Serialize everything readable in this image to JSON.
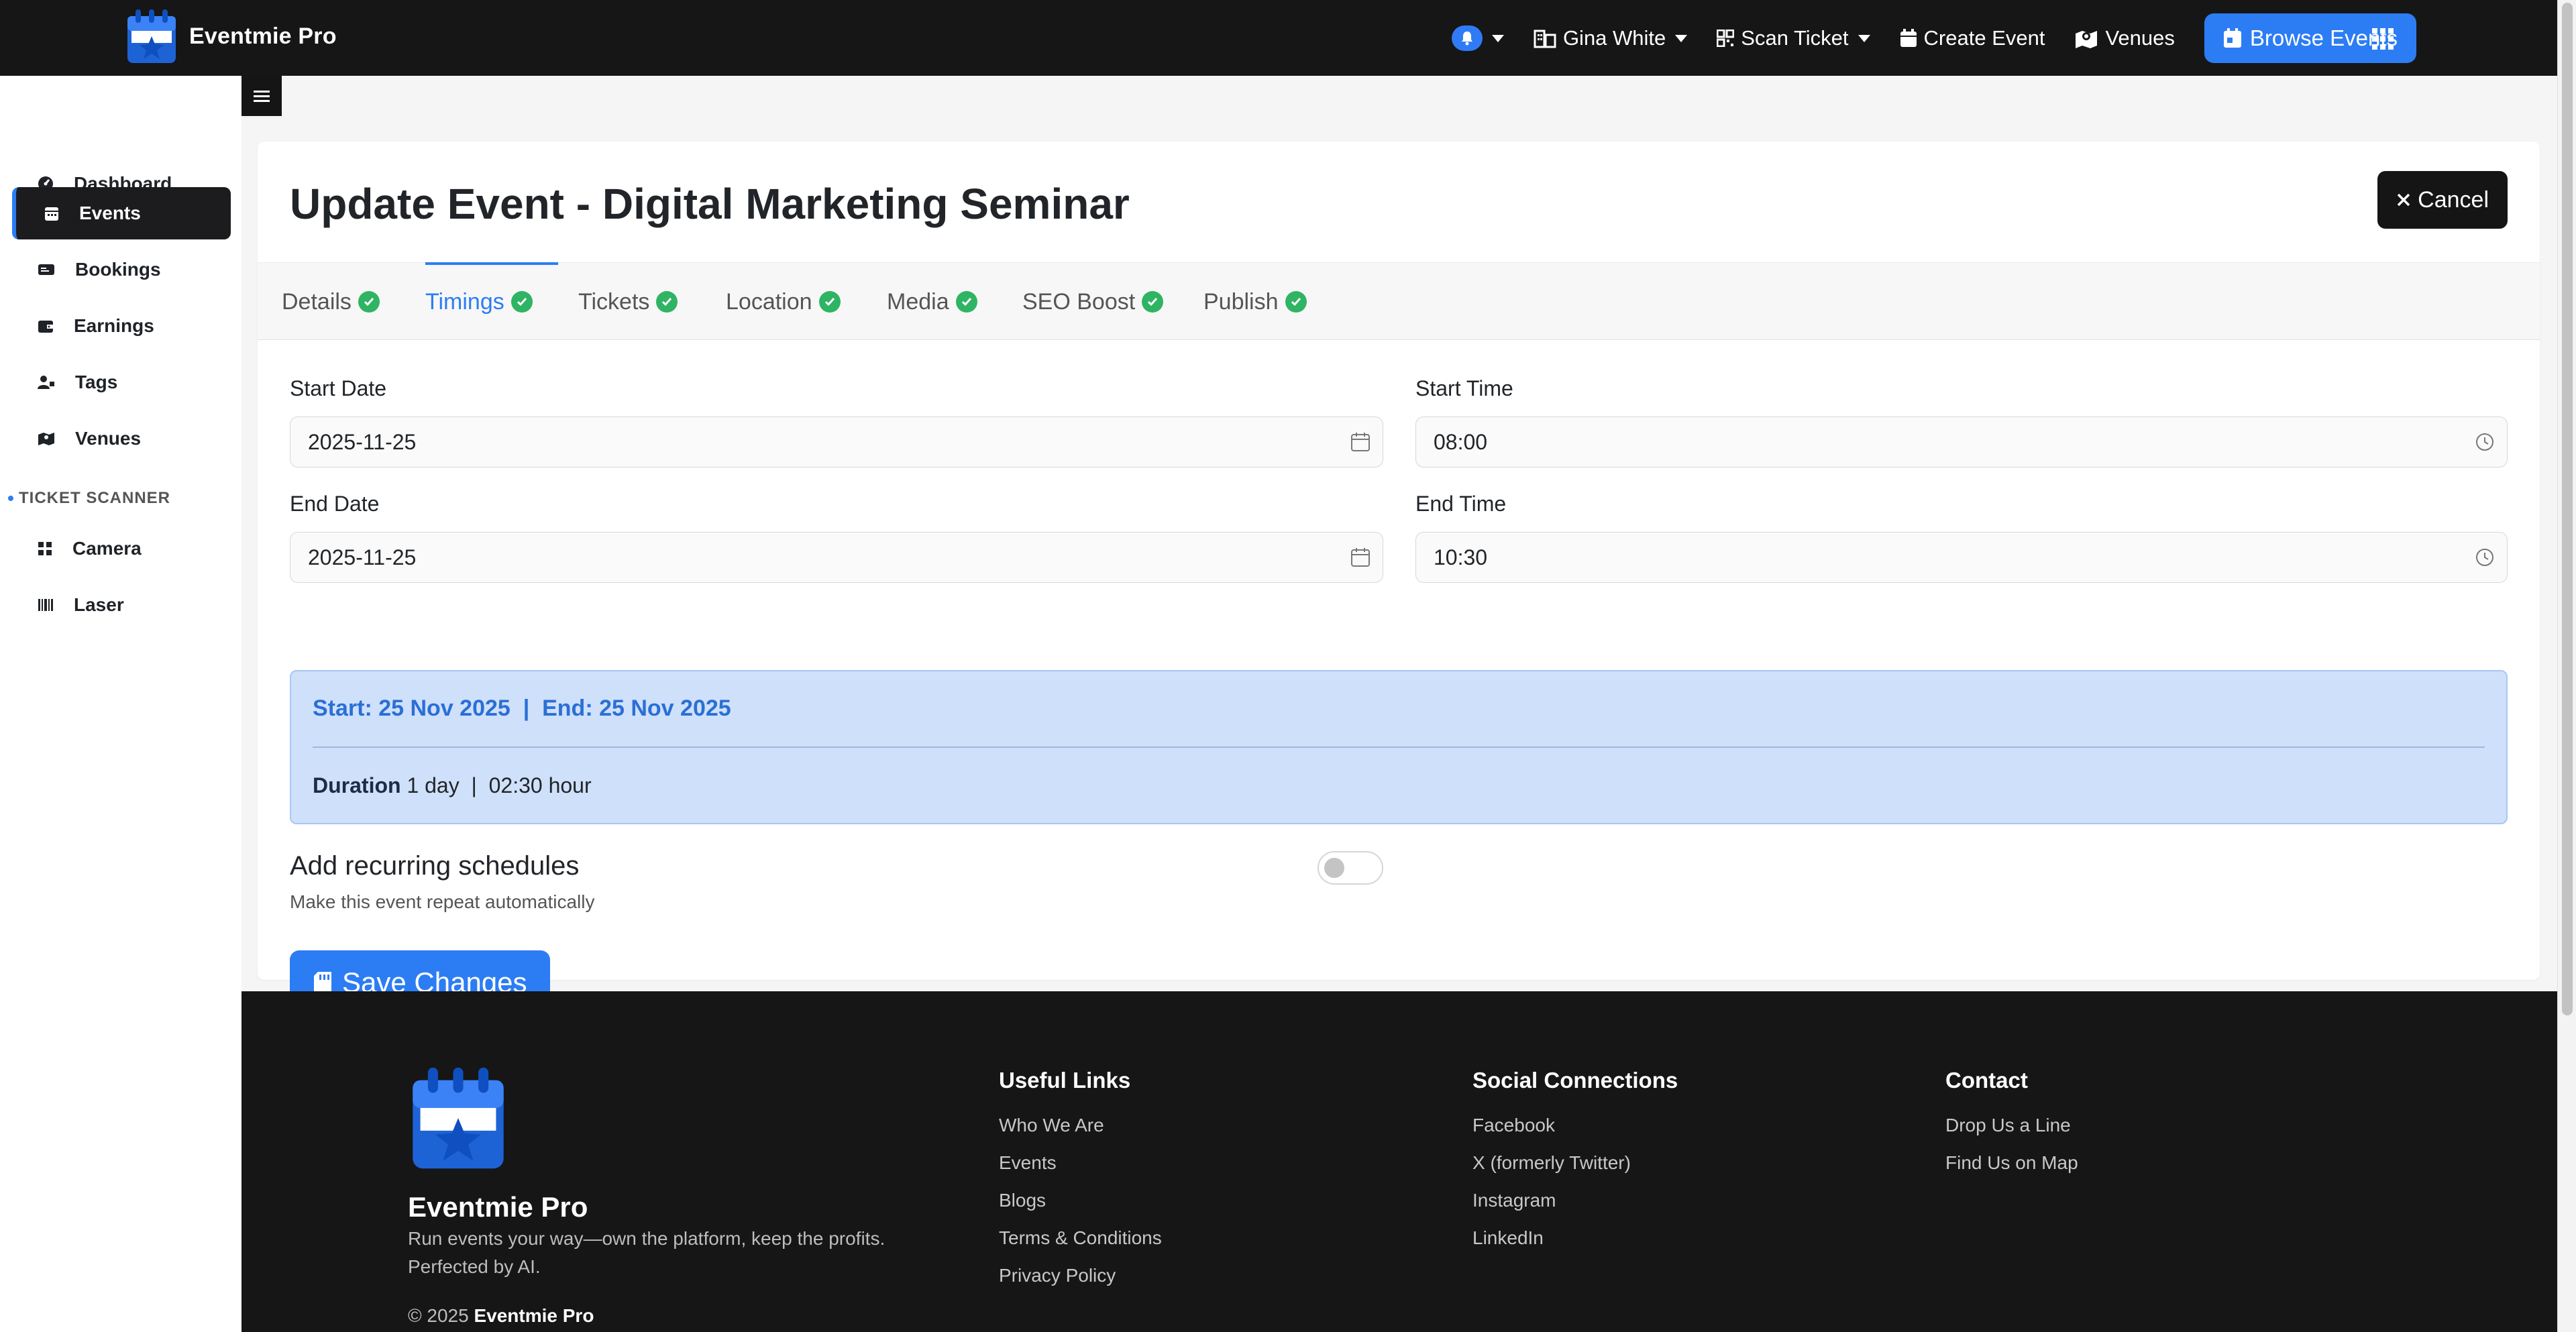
{
  "brand": {
    "name": "Eventmie Pro"
  },
  "topnav": {
    "user": "Gina White",
    "scan_ticket": "Scan Ticket",
    "create_event": "Create Event",
    "venues": "Venues",
    "browse_events": "Browse Events"
  },
  "sidebar": {
    "items": [
      {
        "label": "Dashboard",
        "icon": "dashboard-icon"
      },
      {
        "label": "Events",
        "icon": "calendar-icon",
        "active": true
      },
      {
        "label": "Bookings",
        "icon": "ticket-icon"
      },
      {
        "label": "Earnings",
        "icon": "wallet-icon"
      },
      {
        "label": "Tags",
        "icon": "user-tag-icon"
      },
      {
        "label": "Venues",
        "icon": "map-icon"
      }
    ],
    "section_title": "TICKET SCANNER",
    "scanner_items": [
      {
        "label": "Camera",
        "icon": "qrcode-icon"
      },
      {
        "label": "Laser",
        "icon": "barcode-icon"
      }
    ]
  },
  "page": {
    "title": "Update Event - Digital Marketing Seminar",
    "cancel_label": "Cancel"
  },
  "tabs": [
    {
      "label": "Details",
      "complete": true
    },
    {
      "label": "Timings",
      "complete": true,
      "active": true
    },
    {
      "label": "Tickets",
      "complete": true
    },
    {
      "label": "Location",
      "complete": true
    },
    {
      "label": "Media",
      "complete": true
    },
    {
      "label": "SEO Boost",
      "complete": true
    },
    {
      "label": "Publish",
      "complete": true
    }
  ],
  "form": {
    "start_date_label": "Start Date",
    "start_date": "2025-11-25",
    "start_time_label": "Start Time",
    "start_time": "08:00",
    "end_date_label": "End Date",
    "end_date": "2025-11-25",
    "end_time_label": "End Time",
    "end_time": "10:30"
  },
  "summary": {
    "dates": "Start: 25 Nov 2025  |  End: 25 Nov 2025",
    "duration_label": "Duration",
    "duration_value": " 1 day  |  02:30 hour"
  },
  "recurring": {
    "title": "Add recurring schedules",
    "subtitle": "Make this event repeat automatically",
    "enabled": false
  },
  "save_label": "Save Changes",
  "footer": {
    "brand": "Eventmie Pro",
    "tagline": "Run events your way—own the platform, keep the profits. Perfected by AI.",
    "copyright_prefix": "© 2025 ",
    "copyright_brand": "Eventmie Pro",
    "useful_links": {
      "title": "Useful Links",
      "links": [
        "Who We Are",
        "Events",
        "Blogs",
        "Terms & Conditions",
        "Privacy Policy"
      ]
    },
    "social": {
      "title": "Social Connections",
      "links": [
        "Facebook",
        "X (formerly Twitter)",
        "Instagram",
        "LinkedIn"
      ]
    },
    "contact": {
      "title": "Contact",
      "links": [
        "Drop Us a Line",
        "Find Us on Map"
      ]
    }
  },
  "colors": {
    "accent": "#2c7df4",
    "dark": "#161616",
    "success": "#2fb463",
    "summary_bg": "#cfe0fb"
  }
}
